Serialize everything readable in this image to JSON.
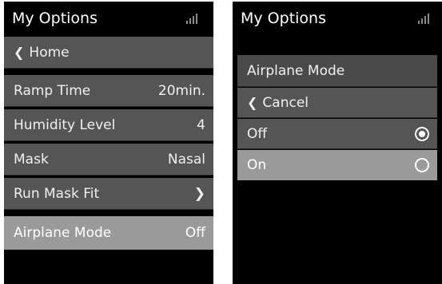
{
  "left_screen": {
    "title": "My Options",
    "back_label": "Home",
    "items": [
      {
        "label": "Ramp Time",
        "value": "20min."
      },
      {
        "label": "Humidity Level",
        "value": "4"
      },
      {
        "label": "Mask",
        "value": "Nasal"
      },
      {
        "label": "Run Mask Fit",
        "value": ""
      },
      {
        "label": "Airplane Mode",
        "value": "Off"
      }
    ]
  },
  "right_screen": {
    "title": "My Options",
    "header": "Airplane Mode",
    "cancel_label": "Cancel",
    "options": [
      {
        "label": "Off",
        "selected": true
      },
      {
        "label": "On",
        "selected": false
      }
    ]
  },
  "colors": {
    "screen_bg": "#000000",
    "row_bg": "#555555",
    "highlight_bg": "#9a9a9a",
    "text": "#f0f0f0"
  },
  "icons": [
    "signal-icon",
    "chevron-left-icon",
    "chevron-right-icon",
    "radio-selected-icon",
    "radio-empty-icon"
  ]
}
